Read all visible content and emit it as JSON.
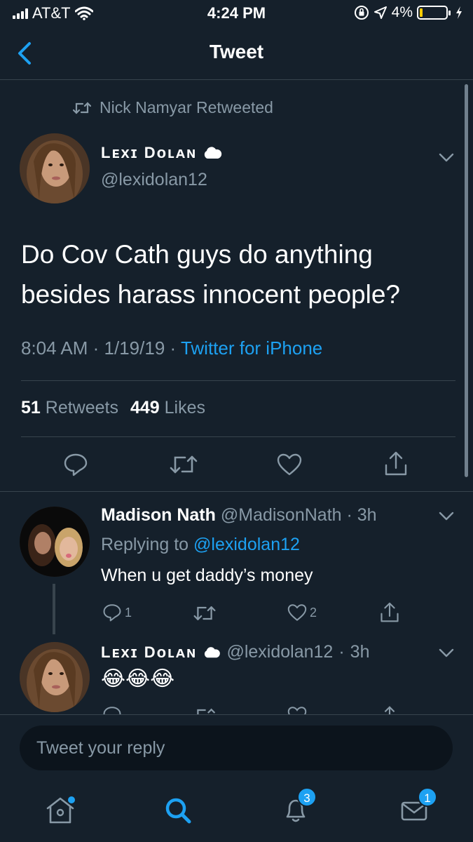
{
  "status_bar": {
    "carrier": "AT&T",
    "time": "4:24 PM",
    "battery": "4%",
    "battery_level": 0.04
  },
  "nav": {
    "title": "Tweet"
  },
  "tweet": {
    "retweeted_by": "Nick Namyar Retweeted",
    "author_name": "Lᴇxɪ Dᴏʟᴀɴ",
    "author_handle": "@lexidolan12",
    "text": "Do Cov Cath guys do anything besides harass innocent people?",
    "time": "8:04 AM",
    "date": "1/19/19",
    "source": "Twitter for iPhone",
    "retweets_count": "51",
    "retweets_label": "Retweets",
    "likes_count": "449",
    "likes_label": "Likes"
  },
  "replies": [
    {
      "author_name": "Madison Nath",
      "author_handle": "@MadisonNath",
      "age": "3h",
      "replying_prefix": "Replying to",
      "replying_to": "@lexidolan12",
      "text": "When u get daddy’s money",
      "reply_count": "1",
      "like_count": "2"
    },
    {
      "author_name": "Lᴇxɪ Dᴏʟᴀɴ",
      "author_handle": "@lexidolan12",
      "age": "3h",
      "text": "😂😂😂"
    }
  ],
  "reply_box": {
    "placeholder": "Tweet your reply"
  },
  "tab_bar": {
    "notifications_badge": "3",
    "messages_badge": "1"
  },
  "colors": {
    "background": "#15202b",
    "accent": "#1da1f2",
    "secondary_text": "#8899a6",
    "divider": "#38444d"
  }
}
